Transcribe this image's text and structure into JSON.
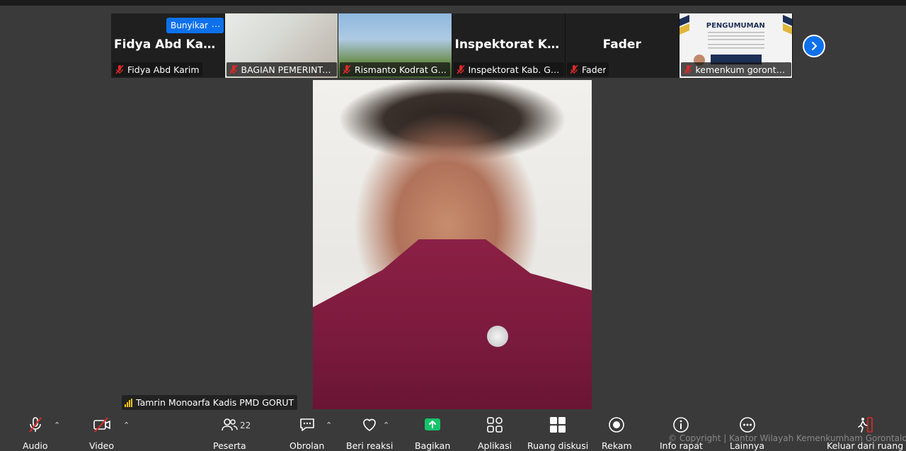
{
  "strip": {
    "tiles": [
      {
        "big_name": "Fidya Abd Karim",
        "label": "Fidya Abd Karim"
      },
      {
        "big_name": "",
        "label": "BAGIAN PEMERINTAH..."
      },
      {
        "big_name": "",
        "label": "Rismanto Kodrat Ganny"
      },
      {
        "big_name": "Inspektorat  Kab...",
        "label": "Inspektorat Kab. Gorut"
      },
      {
        "big_name": "Fader",
        "label": "Fader"
      },
      {
        "big_name": "",
        "label": "kemenkum gorontalo"
      }
    ],
    "unmute_label": "Bunyikan",
    "more_label": "···",
    "poster_title": "PENGUMUMAN"
  },
  "speaker": {
    "name": "Tamrin Monoarfa Kadis PMD GORUT"
  },
  "toolbar": {
    "audio": "Audio",
    "video": "Video",
    "participants": "Peserta",
    "participants_count": "22",
    "chat": "Obrolan",
    "reactions": "Beri reaksi",
    "share": "Bagikan",
    "apps": "Aplikasi",
    "breakout": "Ruang diskusi",
    "record": "Rekam",
    "info": "Info rapat",
    "more": "Lainnya",
    "leave": "Keluar dari ruang"
  },
  "watermark": "© Copyright | Kantor Wilayah Kemenkumham Gorontalo",
  "colors": {
    "accent": "#0e71eb",
    "muted_red": "#e02828",
    "share_green": "#16c46b"
  }
}
